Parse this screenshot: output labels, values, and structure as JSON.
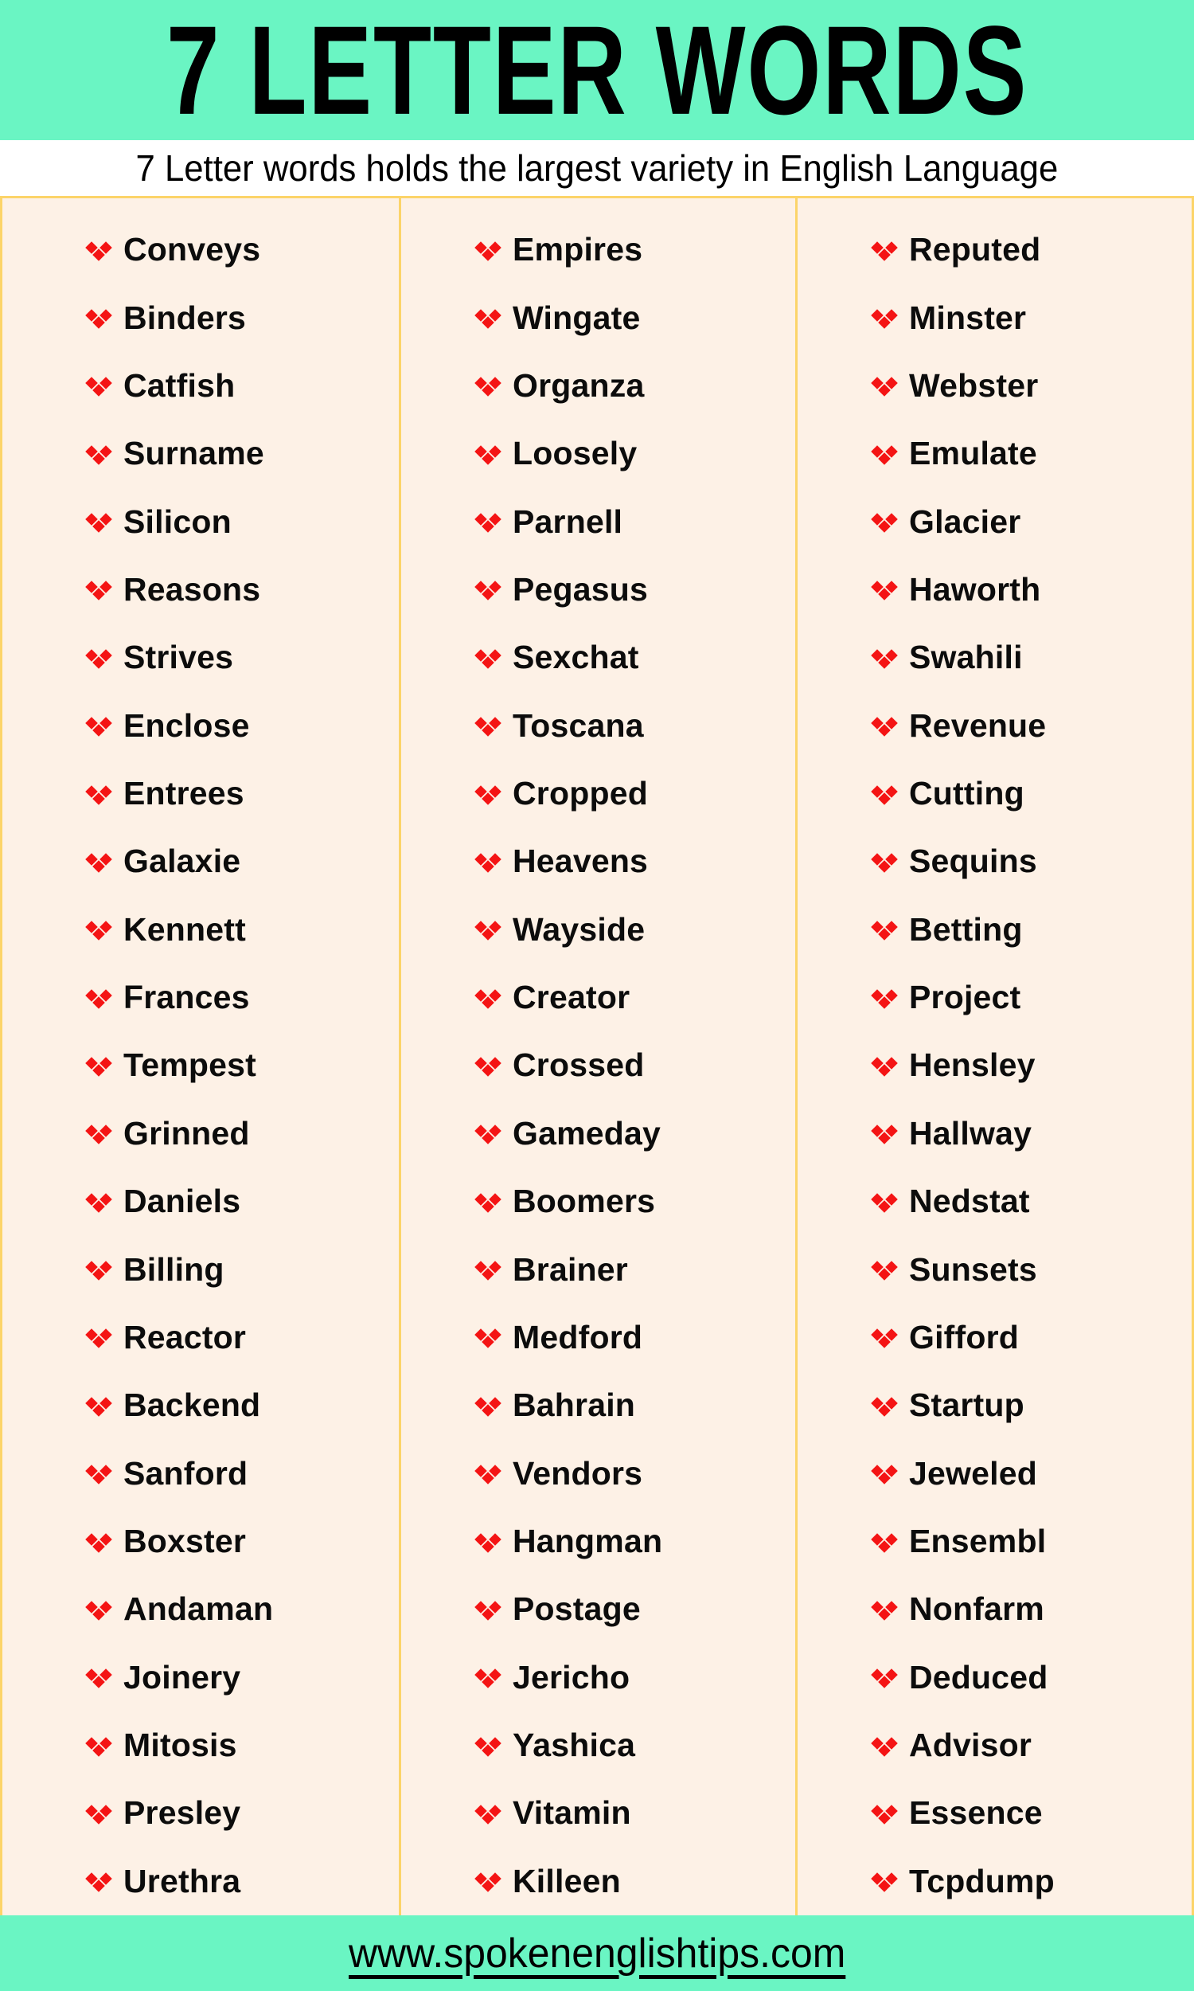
{
  "header": {
    "title": "7 LETTER WORDS",
    "background_color": "#6AF5C3",
    "text_color": "#000000"
  },
  "subtitle": {
    "text": "7 Letter words holds the largest variety in English Language",
    "background_color": "#FFFFFF"
  },
  "content": {
    "background_color": "#FDF1E6",
    "border_color": "#FCD469",
    "bullet_icon": "red-diamond-cluster-bullet",
    "bullet_color": "#F41414",
    "word_color": "#0C0C0C",
    "columns": [
      {
        "index": 1,
        "words": [
          "Conveys",
          "Binders",
          "Catfish",
          "Surname",
          "Silicon",
          "Reasons",
          "Strives",
          "Enclose",
          "Entrees",
          "Galaxie",
          "Kennett",
          "Frances",
          "Tempest",
          "Grinned",
          "Daniels",
          "Billing",
          "Reactor",
          "Backend",
          "Sanford",
          "Boxster",
          "Andaman",
          "Joinery",
          "Mitosis",
          "Presley",
          "Urethra"
        ]
      },
      {
        "index": 2,
        "words": [
          "Empires",
          "Wingate",
          "Organza",
          "Loosely",
          "Parnell",
          "Pegasus",
          "Sexchat",
          "Toscana",
          "Cropped",
          "Heavens",
          "Wayside",
          "Creator",
          "Crossed",
          "Gameday",
          "Boomers",
          "Brainer",
          "Medford",
          "Bahrain",
          "Vendors",
          "Hangman",
          "Postage",
          "Jericho",
          "Yashica",
          "Vitamin",
          "Killeen"
        ]
      },
      {
        "index": 3,
        "words": [
          "Reputed",
          "Minster",
          "Webster",
          "Emulate",
          "Glacier",
          "Haworth",
          "Swahili",
          "Revenue",
          "Cutting",
          "Sequins",
          "Betting",
          "Project",
          "Hensley",
          "Hallway",
          "Nedstat",
          "Sunsets",
          "Gifford",
          "Startup",
          "Jeweled",
          "Ensembl",
          "Nonfarm",
          "Deduced",
          "Advisor",
          "Essence",
          "Tcpdump"
        ]
      }
    ]
  },
  "footer": {
    "url": "www.spokenenglishtips.com",
    "background_color": "#6AF5C3"
  }
}
